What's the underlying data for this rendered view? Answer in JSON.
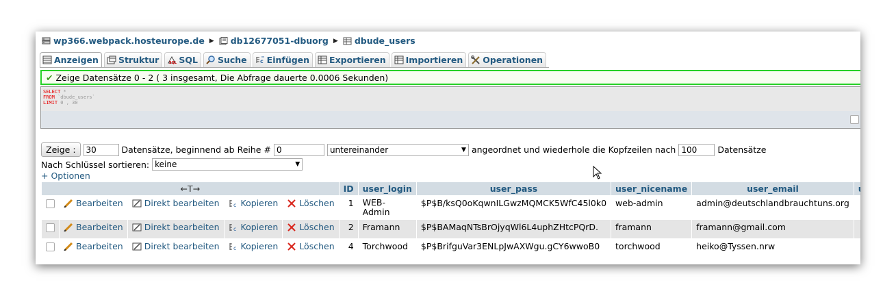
{
  "breadcrumb": {
    "server": "wp366.webpack.hosteurope.de",
    "database": "db12677051-dbuorg",
    "table": "dbude_users"
  },
  "tabs": [
    {
      "label": "Anzeigen",
      "icon": "browse-icon",
      "active": true
    },
    {
      "label": "Struktur",
      "icon": "structure-icon",
      "active": false
    },
    {
      "label": "SQL",
      "icon": "sql-icon",
      "active": false
    },
    {
      "label": "Suche",
      "icon": "search-icon",
      "active": false
    },
    {
      "label": "Einfügen",
      "icon": "insert-icon",
      "active": false
    },
    {
      "label": "Exportieren",
      "icon": "export-icon",
      "active": false
    },
    {
      "label": "Importieren",
      "icon": "import-icon",
      "active": false
    },
    {
      "label": "Operationen",
      "icon": "operations-icon",
      "active": false
    }
  ],
  "success_message": "Zeige Datensätze 0 - 2 ( 3 insgesamt, Die Abfrage dauerte 0.0006 Sekunden)",
  "sql": {
    "line1_kw": "SELECT",
    "line1_rest": " *",
    "line2_kw": "FROM",
    "line2_rest": " `dbude_users`",
    "line3_kw": "LIMIT",
    "line3_rest": " 0 , 30"
  },
  "navigation": {
    "show_button": "Zeige :",
    "rows_value": "30",
    "rows_label": "Datensätze, beginnend ab Reihe #",
    "start_value": "0",
    "mode_select": "untereinander",
    "arranged_label": "angeordnet und wiederhole die Kopfzeilen nach",
    "repeat_value": "100",
    "records_label": "Datensätze",
    "sort_label": "Nach Schlüssel sortieren:",
    "sort_select": "keine",
    "options_link": "+ Optionen"
  },
  "table": {
    "arrows": "←T→",
    "columns": [
      "ID",
      "user_login",
      "user_pass",
      "user_nicename",
      "user_email",
      "user_u"
    ],
    "action_labels": {
      "edit": "Bearbeiten",
      "inline_edit": "Direkt bearbeiten",
      "copy": "Kopieren",
      "delete": "Löschen"
    },
    "rows": [
      {
        "id": "1",
        "login": "WEB-Admin",
        "pass": "$P$B/ksQ0oKqwnILGwzMQMCK5WfC45l0k0",
        "nicename": "web-admin",
        "email": "admin@deutschlandbrauchtuns.org"
      },
      {
        "id": "2",
        "login": "Framann",
        "pass": "$P$BAMaqNTsBrOjyqWl6L4uphZHtcPQrD.",
        "nicename": "framann",
        "email": "framann@gmail.com"
      },
      {
        "id": "4",
        "login": "Torchwood",
        "pass": "$P$BrifguVar3ENLpJwAXWgu.gCY6wwoB0",
        "nicename": "torchwood",
        "email": "heiko@Tyssen.nrw"
      }
    ]
  },
  "colors": {
    "link": "#235a81",
    "header_bg": "#d3dce3",
    "success_border": "#26d126",
    "delete_red": "#d9261c"
  }
}
